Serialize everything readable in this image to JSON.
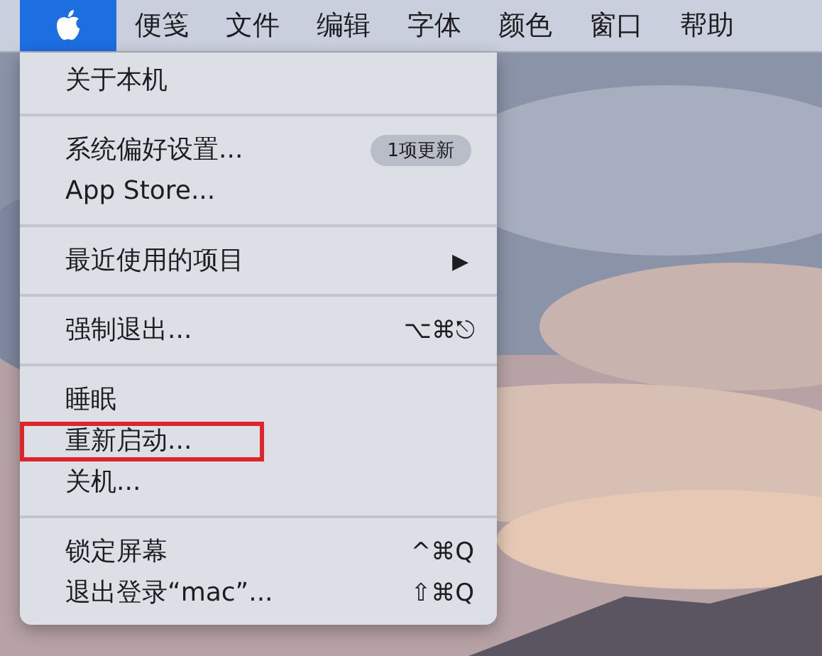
{
  "menu_bar": [
    {
      "kind": "icon",
      "selected": true
    },
    {
      "kind": "text",
      "label": "便笺",
      "selected": false
    },
    {
      "kind": "text",
      "label": "文件",
      "selected": false
    },
    {
      "kind": "text",
      "label": "编辑",
      "selected": false
    },
    {
      "kind": "text",
      "label": "字体",
      "selected": false
    },
    {
      "kind": "text",
      "label": "颜色",
      "selected": false
    },
    {
      "kind": "text",
      "label": "窗口",
      "selected": false
    },
    {
      "kind": "text",
      "label": "帮助",
      "selected": false
    }
  ],
  "menu": {
    "groups": [
      {
        "items": [
          {
            "label": "关于本机",
            "highlighted": false
          }
        ]
      },
      {
        "items": [
          {
            "label": "系统偏好设置...",
            "badge": "1项更新",
            "highlighted": false
          },
          {
            "label": "App Store...",
            "highlighted": false
          }
        ]
      },
      {
        "items": [
          {
            "label": "最近使用的项目",
            "submenu_arrow": "▶",
            "highlighted": false
          }
        ]
      },
      {
        "items": [
          {
            "label": "强制退出...",
            "shortcut": "⌥⌘⎋",
            "highlighted": false
          }
        ]
      },
      {
        "items": [
          {
            "label": "睡眠",
            "highlighted": false
          },
          {
            "label": "重新启动...",
            "highlighted": true
          },
          {
            "label": "关机...",
            "highlighted": false
          }
        ]
      },
      {
        "items": [
          {
            "label": "锁定屏幕",
            "shortcut": "^⌘Q",
            "highlighted": false
          },
          {
            "label": "退出登录“mac”...",
            "shortcut": "⇧⌘Q",
            "highlighted": false
          }
        ]
      }
    ]
  }
}
